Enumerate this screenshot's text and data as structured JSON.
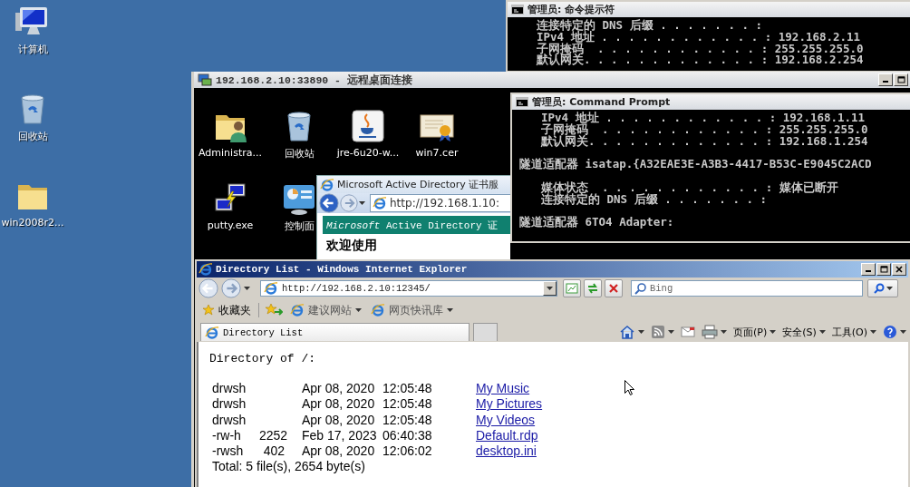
{
  "desktop": {
    "icons": [
      {
        "label": "计算机",
        "kind": "computer"
      },
      {
        "label": "回收站",
        "kind": "recycle-bin"
      },
      {
        "label": "win2008r2...",
        "kind": "folder"
      }
    ]
  },
  "cmd_window": {
    "title": "管理员: 命令提示符",
    "blocks": [
      {
        "kind": "entries",
        "lines": [
          "连接特定的 DNS 后缀 . . . . . . . :",
          "IPv4 地址 . . . . . . . . . . . . : 192.168.2.11",
          "子网掩码  . . . . . . . . . . . . : 255.255.255.0",
          "默认网关. . . . . . . . . . . . . : 192.168.2.254"
        ]
      }
    ]
  },
  "remote_desktop": {
    "title": "192.168.2.10:33890 - 远程桌面连接",
    "icons": [
      {
        "label": "Administra...",
        "kind": "user-folder"
      },
      {
        "label": "回收站",
        "kind": "recycle-bin"
      },
      {
        "label": "jre-6u20-w...",
        "kind": "java"
      },
      {
        "label": "win7.cer",
        "kind": "certificate"
      },
      {
        "label": "putty.exe",
        "kind": "putty"
      },
      {
        "label": "控制面",
        "kind": "control-panel"
      }
    ],
    "cert_browser": {
      "title": "Microsoft Active Directory 证书服",
      "url": "http://192.168.1.10:",
      "banner": "*Microsoft* Active Directory 证",
      "heading": "欢迎使用"
    },
    "cmd_window": {
      "title": "管理员: Command Prompt",
      "blocks": [
        {
          "kind": "entries",
          "lines": [
            "IPv4 地址 . . . . . . . . . . . . : 192.168.1.11",
            "子网掩码  . . . . . . . . . . . . : 255.255.255.0",
            "默认网关. . . . . . . . . . . . . : 192.168.1.254"
          ]
        },
        {
          "kind": "heading",
          "lines": [
            "隧道适配器 isatap.{A32EAE3E-A3B3-4417-B53C-E9045C2ACD"
          ]
        },
        {
          "kind": "entries",
          "lines": [
            "媒体状态  . . . . . . . . . . . . : 媒体已断开",
            "连接特定的 DNS 后缀 . . . . . . . :"
          ]
        },
        {
          "kind": "heading",
          "lines": [
            "隧道适配器 6TO4 Adapter:"
          ]
        }
      ]
    },
    "browser": {
      "title": "Directory List - Windows Internet Explorer",
      "url": "http://192.168.2.10:12345/",
      "search": {
        "placeholder": "Bing"
      },
      "favorites": [
        {
          "label": "收藏夹",
          "kind": "favorites"
        },
        {
          "label": "建议网站",
          "kind": "link"
        },
        {
          "label": "网页快讯库",
          "kind": "link"
        }
      ],
      "tabs": [
        {
          "label": "Directory List",
          "selected": true
        }
      ],
      "commands": [
        {
          "label": "页面(P)"
        },
        {
          "label": "安全(S)"
        },
        {
          "label": "工具(O)"
        }
      ],
      "page": {
        "heading": "Directory of /:",
        "entries": [
          {
            "attributes": "drwsh",
            "date": "Apr 08, 2020",
            "time": "12:05:48",
            "name": "My Music"
          },
          {
            "attributes": "drwsh",
            "date": "Apr 08, 2020",
            "time": "12:05:48",
            "name": "My Pictures"
          },
          {
            "attributes": "drwsh",
            "date": "Apr 08, 2020",
            "time": "12:05:48",
            "name": "My Videos"
          },
          {
            "attributes": "-rw-h",
            "size": "2252",
            "date": "Feb 17, 2023",
            "time": "06:40:38",
            "name": "Default.rdp"
          },
          {
            "attributes": "-rwsh",
            "size": "402",
            "date": "Apr 08, 2020",
            "time": "12:06:02",
            "name": "desktop.ini"
          }
        ],
        "total": "Total: 5 file(s), 2654 byte(s)"
      }
    }
  }
}
